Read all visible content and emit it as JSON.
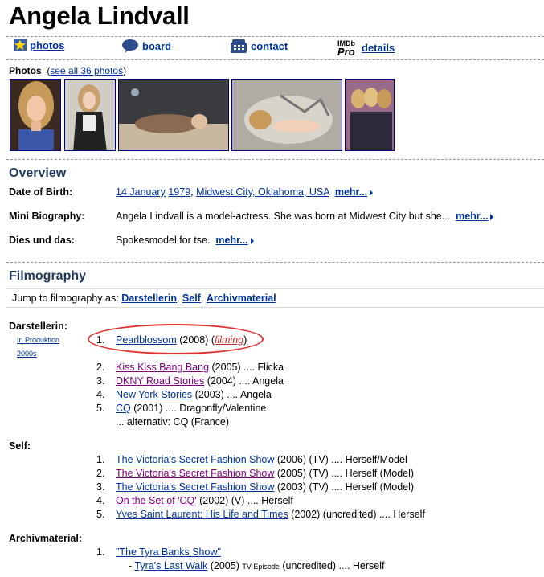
{
  "page": {
    "title": "Angela Lindvall"
  },
  "nav": [
    {
      "label": "photos",
      "icon": "star-icon"
    },
    {
      "label": "board",
      "icon": "speech-bubble-icon"
    },
    {
      "label": "contact",
      "icon": "phone-icon"
    },
    {
      "label": "details",
      "icon": "imdbpro-logo"
    }
  ],
  "photos": {
    "label": "Photos",
    "see_all": "see all 36 photos",
    "open_paren": "(",
    "close_paren": ")"
  },
  "overview": {
    "heading": "Overview",
    "dob_label": "Date of Birth:",
    "dob_day": "14 January",
    "dob_year": "1979",
    "dob_place": "Midwest City, Oklahoma, USA",
    "bio_label": "Mini Biography:",
    "bio_text": "Angela Lindvall is a model-actress. She was born at Midwest City but she...",
    "trivia_label": "Dies und das:",
    "trivia_text": "Spokesmodel for tse.",
    "more": "mehr..."
  },
  "filmography": {
    "heading": "Filmography",
    "jump_text": "Jump to filmography as:",
    "jump_links": [
      "Darstellerin",
      "Self",
      "Archivmaterial"
    ],
    "darstellerin": {
      "label": "Darstellerin:",
      "sublinks": [
        "In Produktion",
        "2000s"
      ],
      "items": [
        {
          "n": "1.",
          "title": "Pearlblossom",
          "rest": " (2008) (",
          "filming": "filming",
          "end": ")"
        },
        {
          "n": "2.",
          "title": "Kiss Kiss Bang Bang",
          "rest": " (2005) .... Flicka"
        },
        {
          "n": "3.",
          "title": "DKNY Road Stories",
          "rest": " (2004) .... Angela"
        },
        {
          "n": "4.",
          "title": "New York Stories",
          "rest": " (2003) .... Angela"
        },
        {
          "n": "5.",
          "title": "CQ",
          "rest": " (2001) .... Dragonfly/Valentine"
        }
      ],
      "alt": "... alternativ: CQ (France)"
    },
    "self": {
      "label": "Self:",
      "items": [
        {
          "n": "1.",
          "title": "The Victoria's Secret Fashion Show",
          "rest": " (2006) (TV) .... Herself/Model"
        },
        {
          "n": "2.",
          "title": "The Victoria's Secret Fashion Show",
          "rest": " (2005) (TV) .... Herself (Model)"
        },
        {
          "n": "3.",
          "title": "The Victoria's Secret Fashion Show",
          "rest": " (2003) (TV) .... Herself (Model)"
        },
        {
          "n": "4.",
          "title": "On the Set of 'CQ'",
          "rest": " (2002) (V) .... Herself"
        },
        {
          "n": "5.",
          "title": "Yves Saint Laurent: His Life and Times",
          "rest": " (2002) (uncredited) .... Herself"
        }
      ]
    },
    "archiv": {
      "label": "Archivmaterial:",
      "items": [
        {
          "n": "1.",
          "title": "\"The Tyra Banks Show\""
        }
      ],
      "episode_prefix": "- ",
      "episode_title": "Tyra's Last Walk",
      "episode_year": " (2005) ",
      "episode_tag": "TV Episode",
      "episode_rest": " (uncredited) .... Herself"
    }
  }
}
